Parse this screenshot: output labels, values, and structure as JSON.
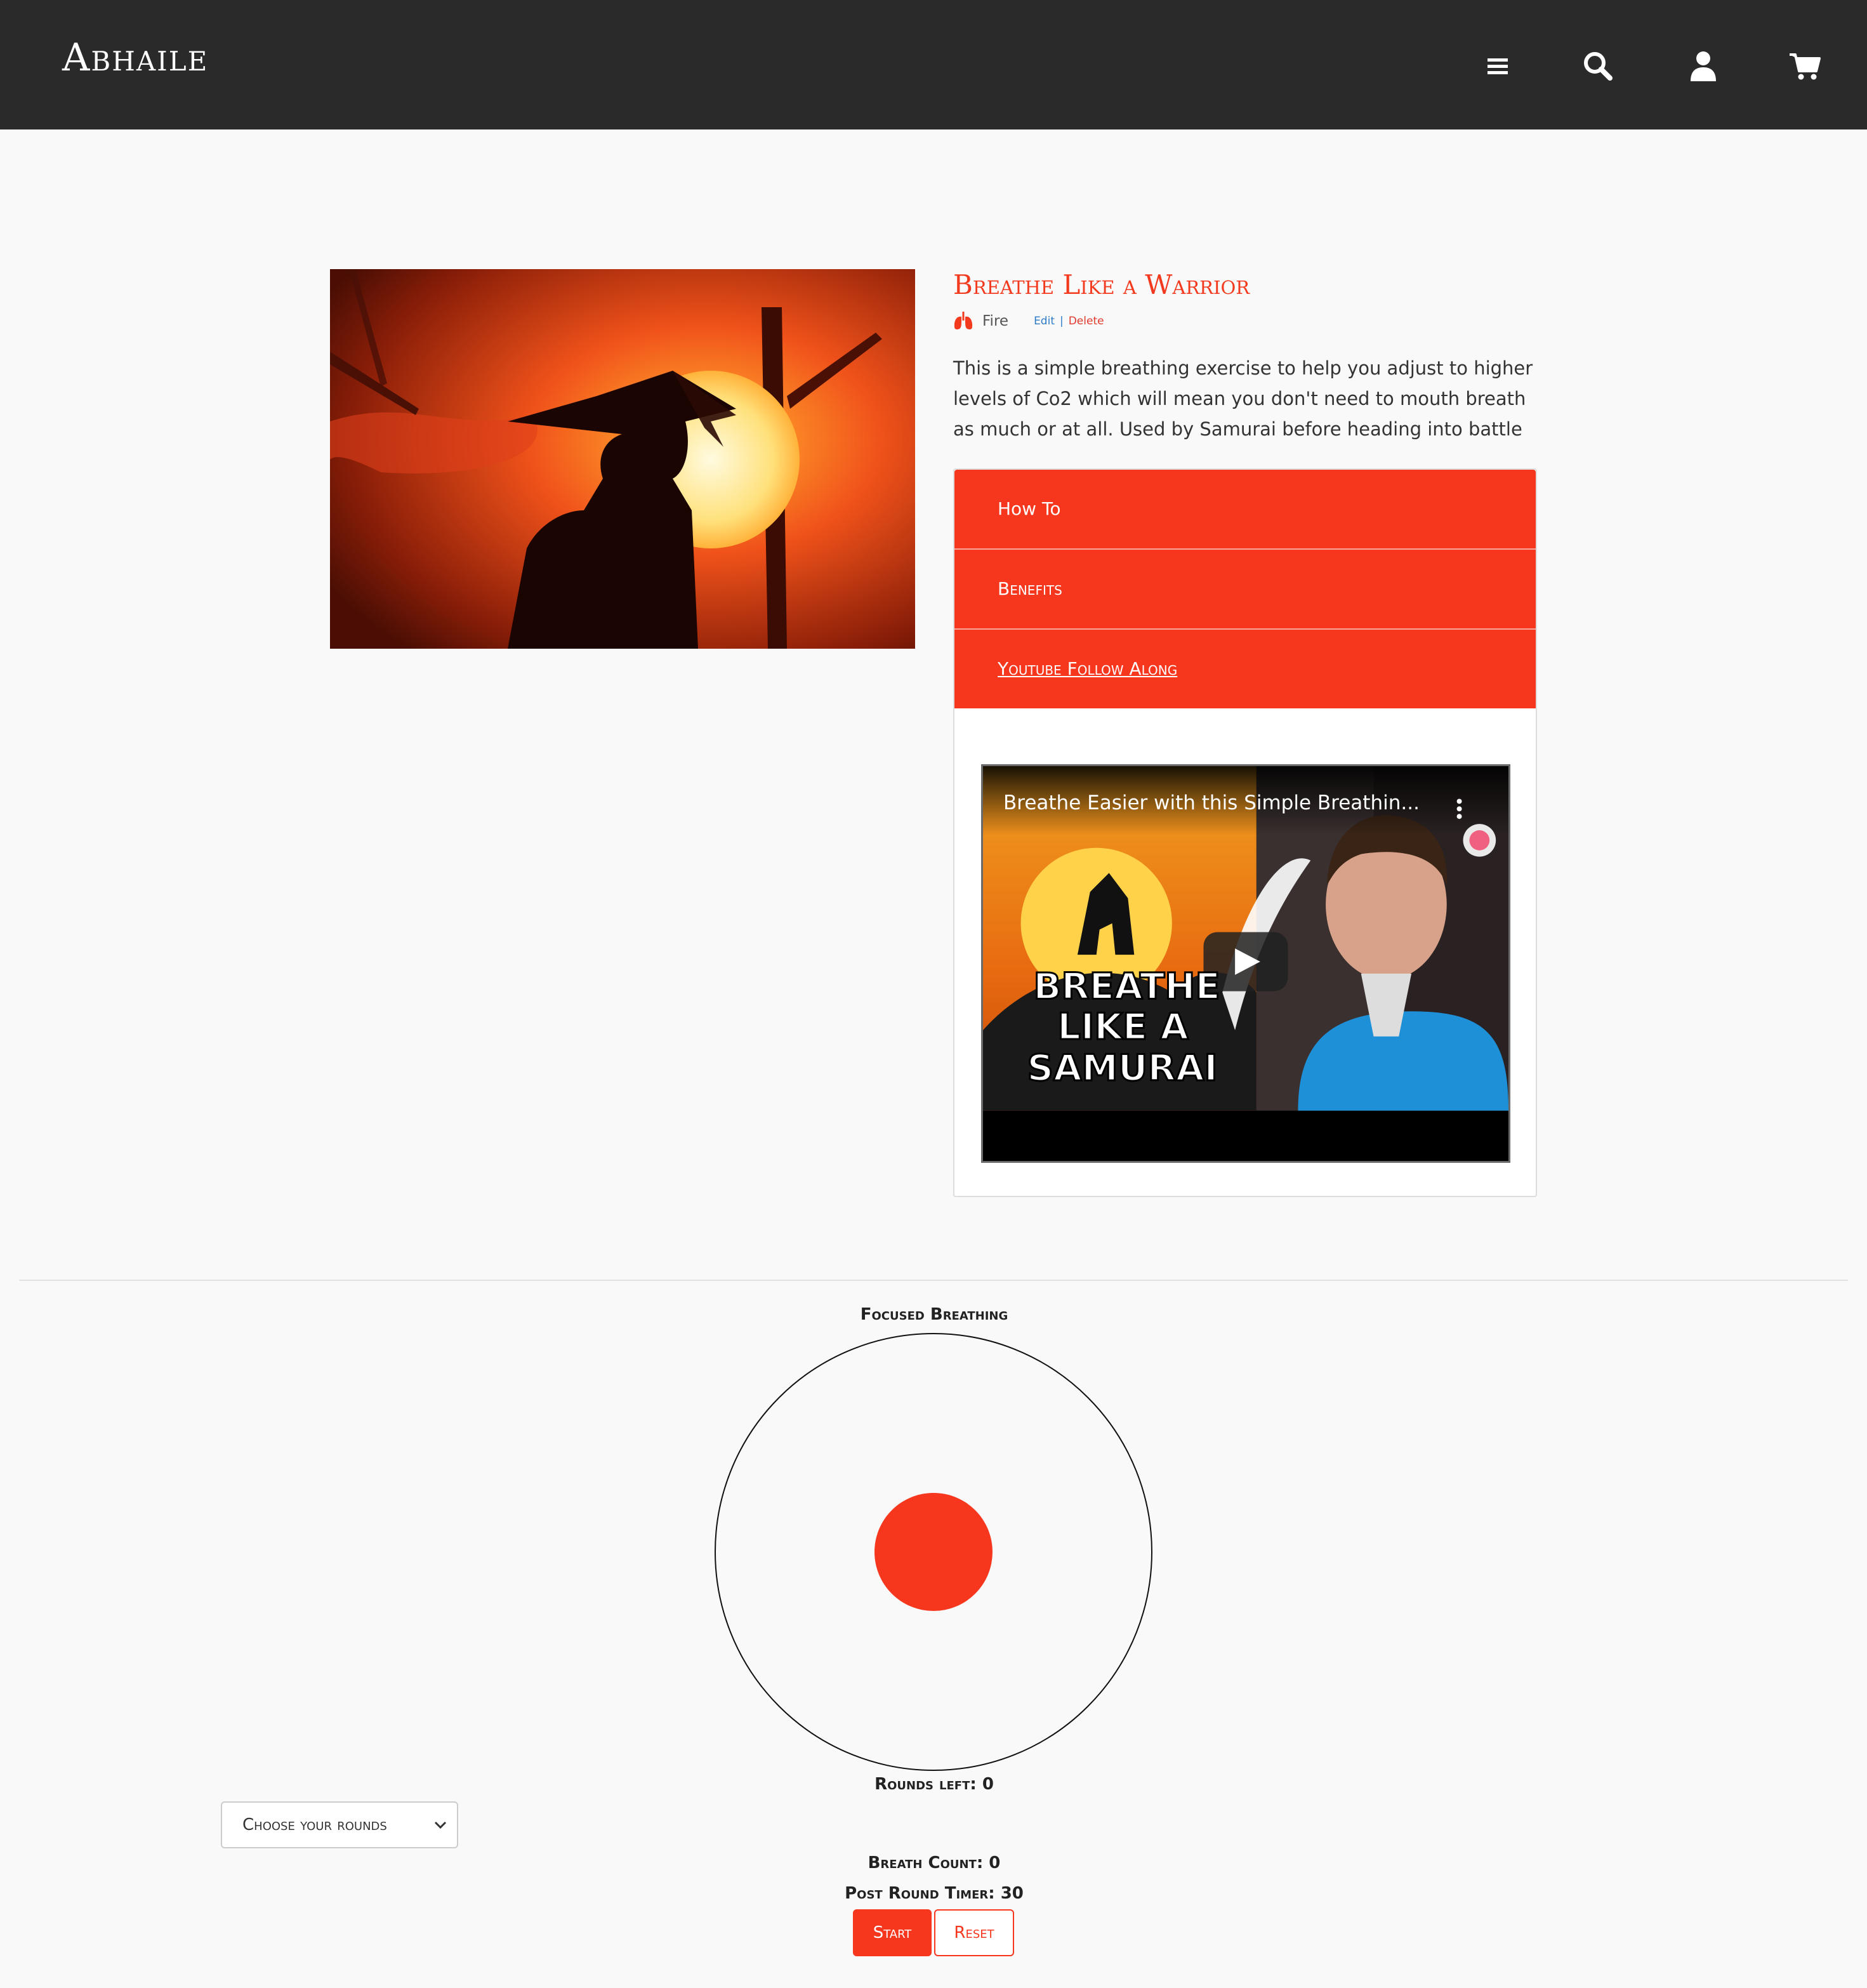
{
  "header": {
    "logo": "Abhaile",
    "icons": [
      "menu-icon",
      "search-icon",
      "user-icon",
      "cart-icon"
    ]
  },
  "exercise": {
    "title": "Breathe Like a Warrior",
    "element": "Fire",
    "edit_label": "Edit",
    "separator": "|",
    "delete_label": "Delete",
    "description": "This is a simple breathing exercise to help you adjust to higher levels of Co2 which will mean you don't need to mouth breath as much or at all. Used by Samurai before heading into battle"
  },
  "accordion": {
    "items": [
      {
        "label": "How To"
      },
      {
        "label": "Benefits"
      },
      {
        "label": "Youtube Follow Along"
      }
    ],
    "video": {
      "title": "Breathe Easier with this Simple Breathin...",
      "thumb_lines": [
        "BREATHE",
        "LIKE A",
        "SAMURAI"
      ]
    }
  },
  "trainer": {
    "title": "Focused Breathing",
    "rounds_left_label": "Rounds left:",
    "rounds_left": "0",
    "breath_count_label": "Breath Count:",
    "breath_count": "0",
    "post_timer_label": "Post Round Timer:",
    "post_timer": "30",
    "select_placeholder": "Choose your rounds",
    "start_label": "Start",
    "reset_label": "Reset"
  },
  "colors": {
    "accent": "#f7361e",
    "header_bg": "#2a2a2a",
    "background": "#f9f9f9"
  }
}
